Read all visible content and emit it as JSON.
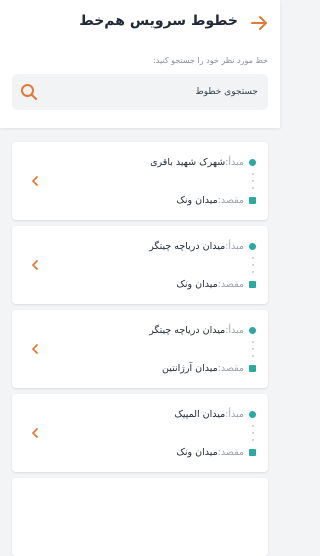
{
  "header": {
    "title": "خطوط سرویس هم‌خط",
    "hint": "خط مورد نظر خود را جستجو کنید:"
  },
  "search": {
    "placeholder": "جستجوی خطوط",
    "value": ""
  },
  "labels": {
    "origin": "مبدأ:",
    "destination": "مقصد:"
  },
  "routes": [
    {
      "origin": "شهرک شهید باقری",
      "destination": "میدان ونک"
    },
    {
      "origin": "میدان دریاچه چیتگر",
      "destination": "میدان ونک"
    },
    {
      "origin": "میدان دریاچه چیتگر",
      "destination": "میدان آرژانتین"
    },
    {
      "origin": "میدان المپیک",
      "destination": "میدان ونک"
    }
  ],
  "colors": {
    "accent": "#e07a3a",
    "teal": "#2ba8a0",
    "background": "#f3f4f6"
  },
  "icons": {
    "back": "arrow-right-icon",
    "search": "search-icon",
    "open_route": "chevron-left-icon"
  }
}
